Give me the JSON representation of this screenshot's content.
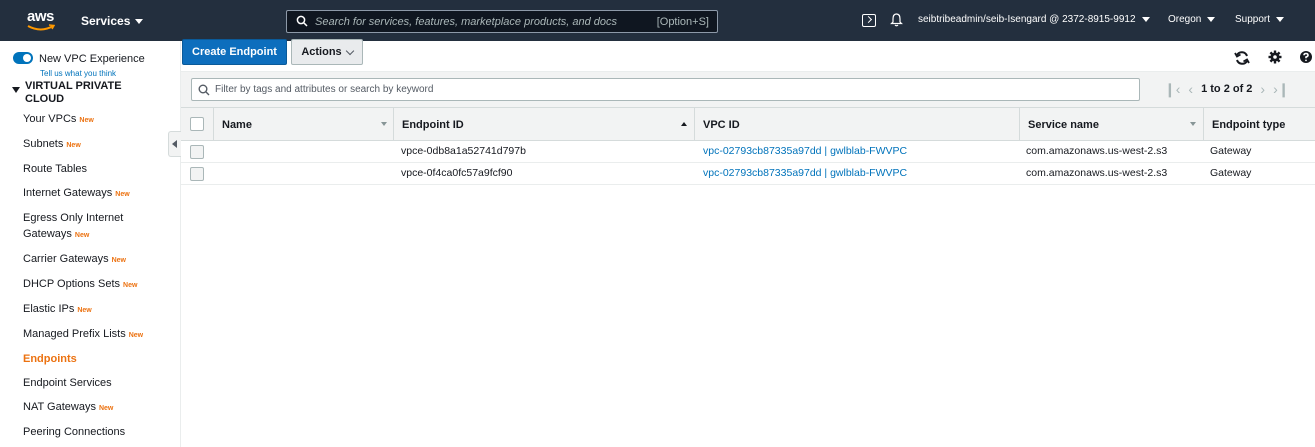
{
  "topnav": {
    "logo_text": "aws",
    "services_label": "Services",
    "search_placeholder": "Search for services, features, marketplace products, and docs",
    "search_shortcut": "[Option+S]",
    "account": "seibtribeadmin/seib-Isengard @ 2372-8915-9912",
    "region": "Oregon",
    "support": "Support",
    "icons": [
      "cloudshell-icon",
      "bell-icon"
    ]
  },
  "sidebar": {
    "toggle_label": "New VPC Experience",
    "toggle_on": true,
    "tell_us": "Tell us what you think",
    "section_title": "VIRTUAL PRIVATE CLOUD",
    "new_badge": "New",
    "items": [
      {
        "label": "Your VPCs",
        "new": true
      },
      {
        "label": "Subnets",
        "new": true
      },
      {
        "label": "Route Tables",
        "new": false
      },
      {
        "label": "Internet Gateways",
        "new": true
      },
      {
        "label": "Egress Only Internet Gateways",
        "new": true
      },
      {
        "label": "Carrier Gateways",
        "new": true
      },
      {
        "label": "DHCP Options Sets",
        "new": true
      },
      {
        "label": "Elastic IPs",
        "new": true
      },
      {
        "label": "Managed Prefix Lists",
        "new": true
      },
      {
        "label": "Endpoints",
        "new": false,
        "active": true
      },
      {
        "label": "Endpoint Services",
        "new": false
      },
      {
        "label": "NAT Gateways",
        "new": true
      },
      {
        "label": "Peering Connections",
        "new": false
      }
    ]
  },
  "toolbar": {
    "create_label": "Create Endpoint",
    "actions_label": "Actions",
    "icons": [
      "refresh-icon",
      "settings-icon",
      "help-icon"
    ]
  },
  "filter": {
    "placeholder": "Filter by tags and attributes or search by keyword",
    "pager_text": "1 to 2 of 2"
  },
  "table": {
    "columns": [
      "Name",
      "Endpoint ID",
      "VPC ID",
      "Service name",
      "Endpoint type"
    ],
    "rows": [
      {
        "name": "",
        "endpoint_id": "vpce-0db8a1a52741d797b",
        "vpc_id": "vpc-02793cb87335a97dd | gwlblab-FWVPC",
        "service_name": "com.amazonaws.us-west-2.s3",
        "endpoint_type": "Gateway"
      },
      {
        "name": "",
        "endpoint_id": "vpce-0f4ca0fc57a9fcf90",
        "vpc_id": "vpc-02793cb87335a97dd | gwlblab-FWVPC",
        "service_name": "com.amazonaws.us-west-2.s3",
        "endpoint_type": "Gateway"
      }
    ]
  },
  "colors": {
    "nav_bg": "#232f3e",
    "primary": "#0d6ebd",
    "active": "#ec7211",
    "link": "#0073bb"
  }
}
